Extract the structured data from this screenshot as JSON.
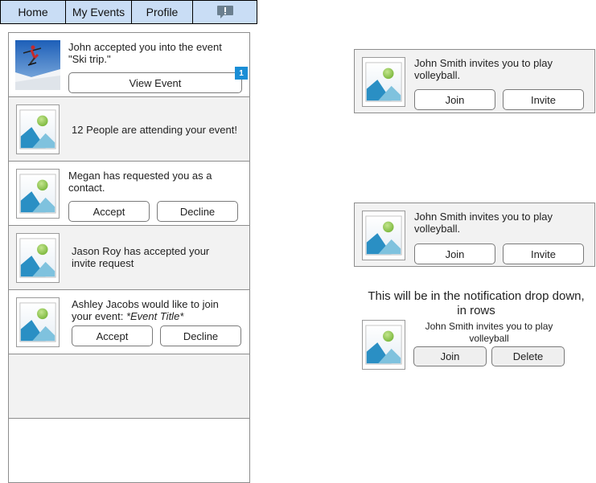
{
  "nav": {
    "tabs": [
      "Home",
      "My Events",
      "Profile"
    ],
    "notifications_icon": "speech-bubble-exclamation-icon"
  },
  "notifications": [
    {
      "image": "ski-photo",
      "text_line1": "John accepted you into the event",
      "text_line2": "\"Ski trip.\"",
      "button": "View Event",
      "badge": "1"
    },
    {
      "image": "placeholder-image-icon",
      "text": "12 People are attending your event!"
    },
    {
      "image": "placeholder-image-icon",
      "text_line1": "Megan has requested you as a",
      "text_line2": "contact.",
      "accept": "Accept",
      "decline": "Decline"
    },
    {
      "image": "placeholder-image-icon",
      "text_line1": "Jason Roy has accepted your",
      "text_line2": "invite request"
    },
    {
      "image": "placeholder-image-icon",
      "text_line1": "Ashley Jacobs would like to join",
      "text_line2_prefix": "your event: ",
      "text_line2_italic": "*Event Title*",
      "accept": "Accept",
      "decline": "Decline"
    }
  ],
  "cards": [
    {
      "text_line1": "John Smith invites you to play",
      "text_line2": "volleyball.",
      "join": "Join",
      "invite": "Invite"
    },
    {
      "text_line1": "John Smith invites you to play",
      "text_line2": "volleyball.",
      "join": "Join",
      "invite": "Invite"
    }
  ],
  "dropdown_note": {
    "line1": "This will be in the notification drop down,",
    "line2": "in rows"
  },
  "dropdown_example": {
    "text_line1": "John Smith invites you to play",
    "text_line2": "volleyball",
    "join": "Join",
    "delete": "Delete"
  },
  "colors": {
    "nav_background": "#c9ddf5",
    "badge": "#1a8ed6",
    "row_gray": "#f2f2f2",
    "border": "#8d8d8d"
  }
}
